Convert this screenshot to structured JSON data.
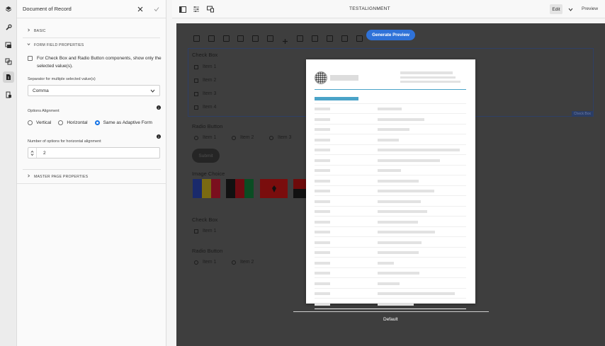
{
  "panel": {
    "title": "Document of Record",
    "sections": {
      "basic": "BASIC",
      "form_field": "FORM FIELD PROPERTIES",
      "master_page": "MASTER PAGE PROPERTIES"
    },
    "selected_values_checkbox": {
      "label": "For Check Box and Radio Button components, show only the selected value(s).",
      "checked": false
    },
    "separator": {
      "label": "Separator for multiple selected value(s)",
      "value": "Comma"
    },
    "options_alignment": {
      "label": "Options Alignment",
      "options": [
        "Vertical",
        "Horizontal",
        "Same as Adaptive Form"
      ],
      "selected": "Same as Adaptive Form"
    },
    "horizontal_count": {
      "label": "Number of options for horizontal alignment",
      "value": "2"
    }
  },
  "toolbar": {
    "title": "TESTALIGNMENT",
    "edit_label": "Edit",
    "preview_label": "Preview"
  },
  "canvas": {
    "generate_preview_label": "Generate Preview",
    "checkbox1": {
      "title": "Check Box",
      "items": [
        "Item 1",
        "Item 2",
        "Item 3",
        "Item 4"
      ],
      "tag": "Check Box"
    },
    "radio1": {
      "title": "Radio Button",
      "items": [
        "Item 1",
        "Item 2",
        "Item 3"
      ]
    },
    "submit_label": "Submit",
    "image_choice_title": "Image Choice",
    "checkbox2": {
      "title": "Check Box",
      "items": [
        "Item 1"
      ]
    },
    "radio2": {
      "title": "Radio Button",
      "items": [
        "Item 1",
        "Item 2"
      ]
    },
    "default_label": "Default"
  },
  "colors": {
    "accent": "#2f72d8",
    "canvas_bg": "#3e3e3e",
    "preview_header_line": "#4aa3c8"
  }
}
